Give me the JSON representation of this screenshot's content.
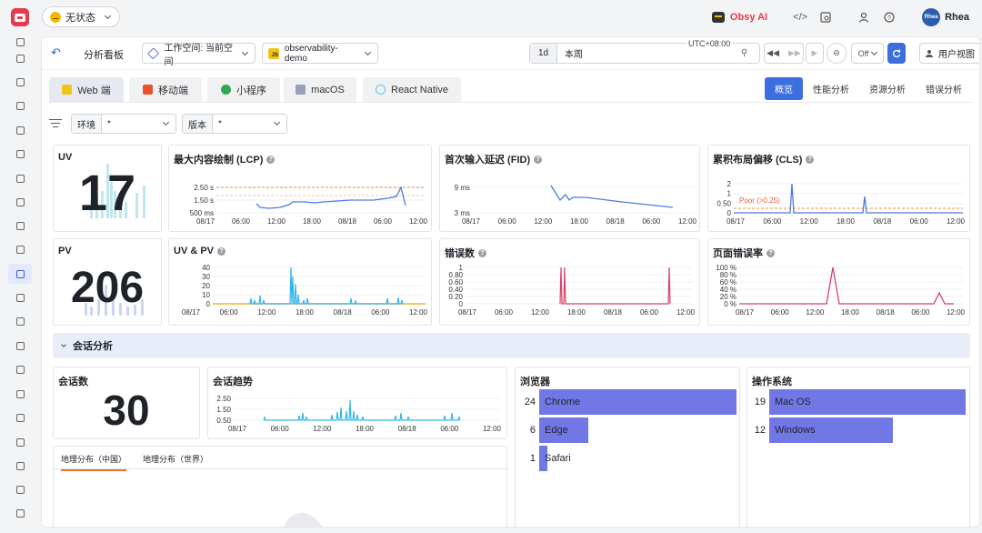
{
  "topbar": {
    "status_label": "无状态",
    "obsy_label": "Obsy AI",
    "avatar_text": "Rhea",
    "user_name": "Rhea"
  },
  "toolbar": {
    "title": "分析看板",
    "workspace_label": "工作空间: 当前空间",
    "app_name": "observability-demo",
    "app_icon_text": "JS",
    "time_unit": "1d",
    "time_value": "本周",
    "timezone": "UTC+08:00",
    "refresh_mode": "Off",
    "user_view_label": "用户视图"
  },
  "platform_tabs": [
    {
      "label": "Web 端",
      "icon_text": "JS",
      "color": "#f0c419"
    },
    {
      "label": "移动端",
      "icon_text": "",
      "color": "#e8532e"
    },
    {
      "label": "小程序",
      "icon_text": "",
      "color": "#2fa84f"
    },
    {
      "label": "macOS",
      "icon_text": "",
      "color": "#9aa0b8"
    },
    {
      "label": "React Native",
      "icon_text": "",
      "color": "#61c3e6"
    }
  ],
  "view_tabs": [
    "概览",
    "性能分析",
    "资源分析",
    "错误分析"
  ],
  "filters": [
    {
      "key": "环境",
      "value": "*"
    },
    {
      "key": "版本",
      "value": "*"
    }
  ],
  "stats": {
    "uv": {
      "title": "UV",
      "value": "17"
    },
    "pv": {
      "title": "PV",
      "value": "206"
    }
  },
  "charts": {
    "x_ticks": [
      "08/17",
      "06:00",
      "12:00",
      "18:00",
      "08/18",
      "06:00",
      "12:00"
    ],
    "lcp": {
      "title": "最大内容绘制 (LCP)",
      "y_ticks": [
        "2.50 s",
        "1.50 s",
        "500 ms"
      ]
    },
    "fid": {
      "title": "首次输入延迟 (FID)",
      "y_ticks": [
        "9 ms",
        "3 ms"
      ]
    },
    "cls": {
      "title": "累积布局偏移 (CLS)",
      "y_ticks": [
        "2",
        "1",
        "0.50",
        "0"
      ],
      "threshold_label": "Poor (>0.25)"
    },
    "uvpv": {
      "title": "UV & PV",
      "y_ticks": [
        "40",
        "30",
        "20",
        "10",
        "0"
      ]
    },
    "errors": {
      "title": "错误数",
      "y_ticks": [
        "1",
        "0.80",
        "0.60",
        "0.40",
        "0.20",
        "0"
      ]
    },
    "error_rate": {
      "title": "页面错误率",
      "y_ticks": [
        "100 %",
        "80 %",
        "60 %",
        "40 %",
        "20 %",
        "0 %"
      ]
    },
    "session_trend": {
      "title": "会话趋势",
      "y_ticks": [
        "2.50",
        "1.50",
        "0.50"
      ]
    }
  },
  "session": {
    "section_title": "会话分析",
    "count_title": "会话数",
    "count_value": "30",
    "browser_title": "浏览器",
    "os_title": "操作系统",
    "geo_tabs": [
      "地理分布（中国）",
      "地理分布（世界）"
    ]
  },
  "chart_data": {
    "type": "bar",
    "charts": [
      {
        "name": "浏览器",
        "type": "bar",
        "orientation": "horizontal",
        "categories": [
          "Chrome",
          "Edge",
          "Safari"
        ],
        "values": [
          24,
          6,
          1
        ]
      },
      {
        "name": "操作系统",
        "type": "bar",
        "orientation": "horizontal",
        "categories": [
          "Mac OS",
          "Windows"
        ],
        "values": [
          19,
          12
        ]
      }
    ]
  },
  "colors": {
    "accent": "#3b6fe0",
    "bar": "#7277e6",
    "error_line": "#d8416b",
    "lcp_line": "#4f7ae0",
    "uv_series": "#33b6e8",
    "pv_series": "#f0b520",
    "threshold": "#f08a4b"
  }
}
